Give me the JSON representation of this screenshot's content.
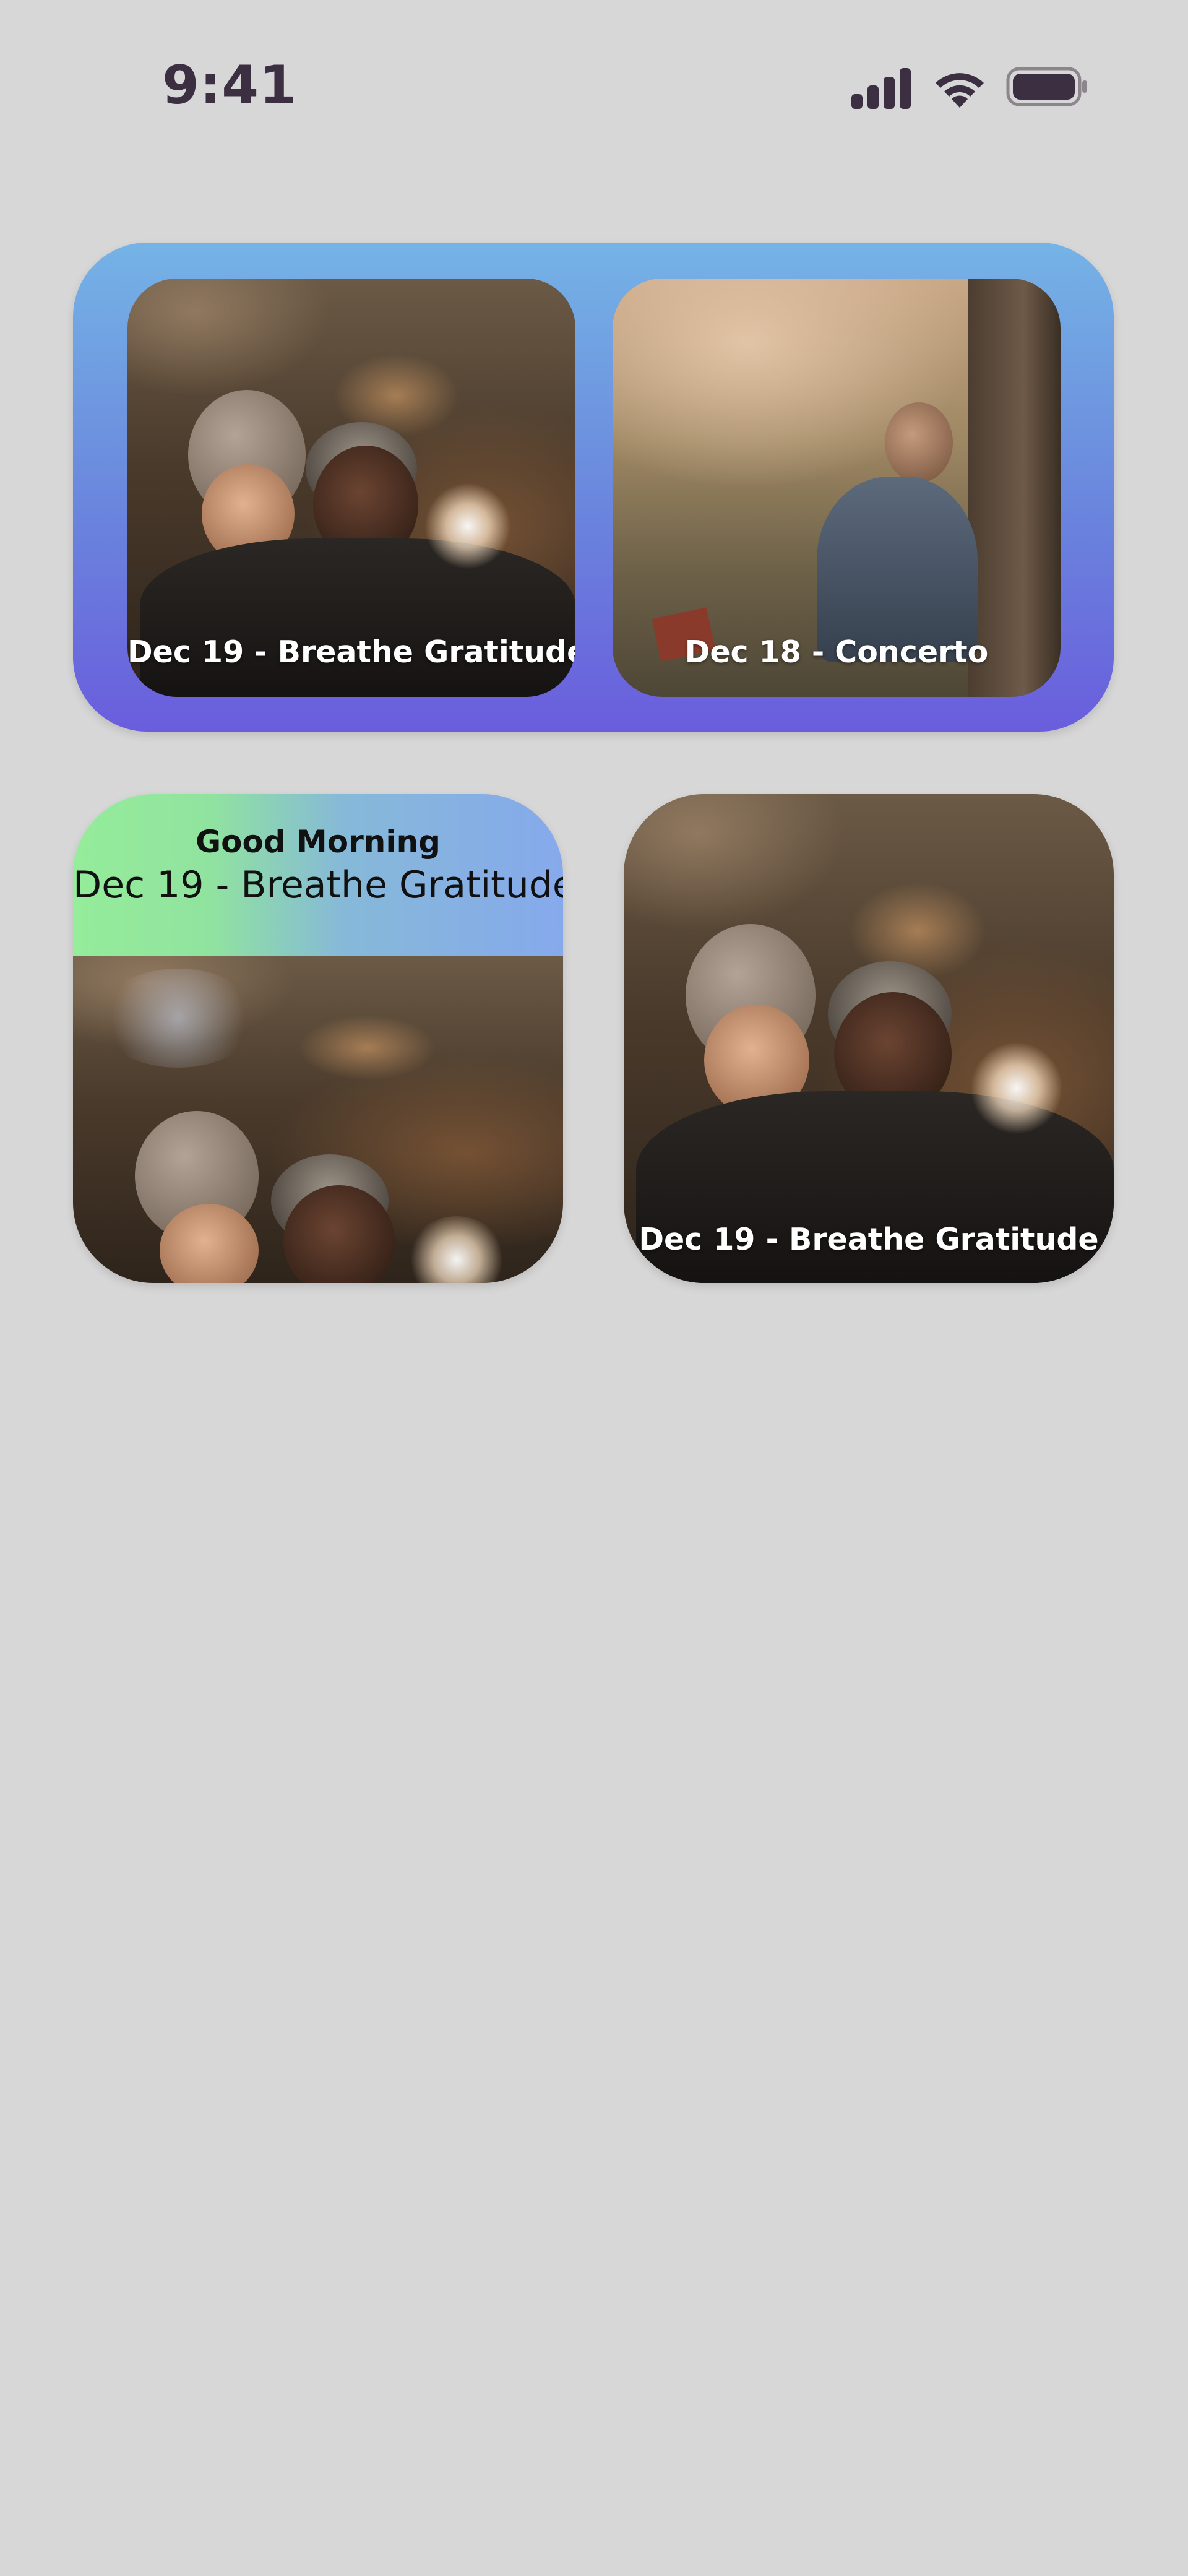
{
  "status_bar": {
    "time": "9:41",
    "icons": [
      "signal-icon",
      "wifi-icon",
      "battery-icon"
    ]
  },
  "widgets": {
    "wide": {
      "photos": [
        {
          "caption": "Dec 19 - Breathe Gratitude"
        },
        {
          "caption": "Dec 18 - Concerto"
        }
      ]
    },
    "greeting": {
      "title": "Good Morning",
      "subtitle": "Dec 19 - Breathe Gratitude"
    },
    "single": {
      "caption": "Dec 19 - Breathe Gratitude"
    }
  },
  "colors": {
    "background": "#d7d7d7",
    "status_text": "#3d2f42",
    "wide_gradient_top": "#75b3e6",
    "wide_gradient_bottom": "#6a5ddd",
    "greeting_gradient_left": "#95ec9a",
    "greeting_gradient_right": "#86a9ec"
  }
}
